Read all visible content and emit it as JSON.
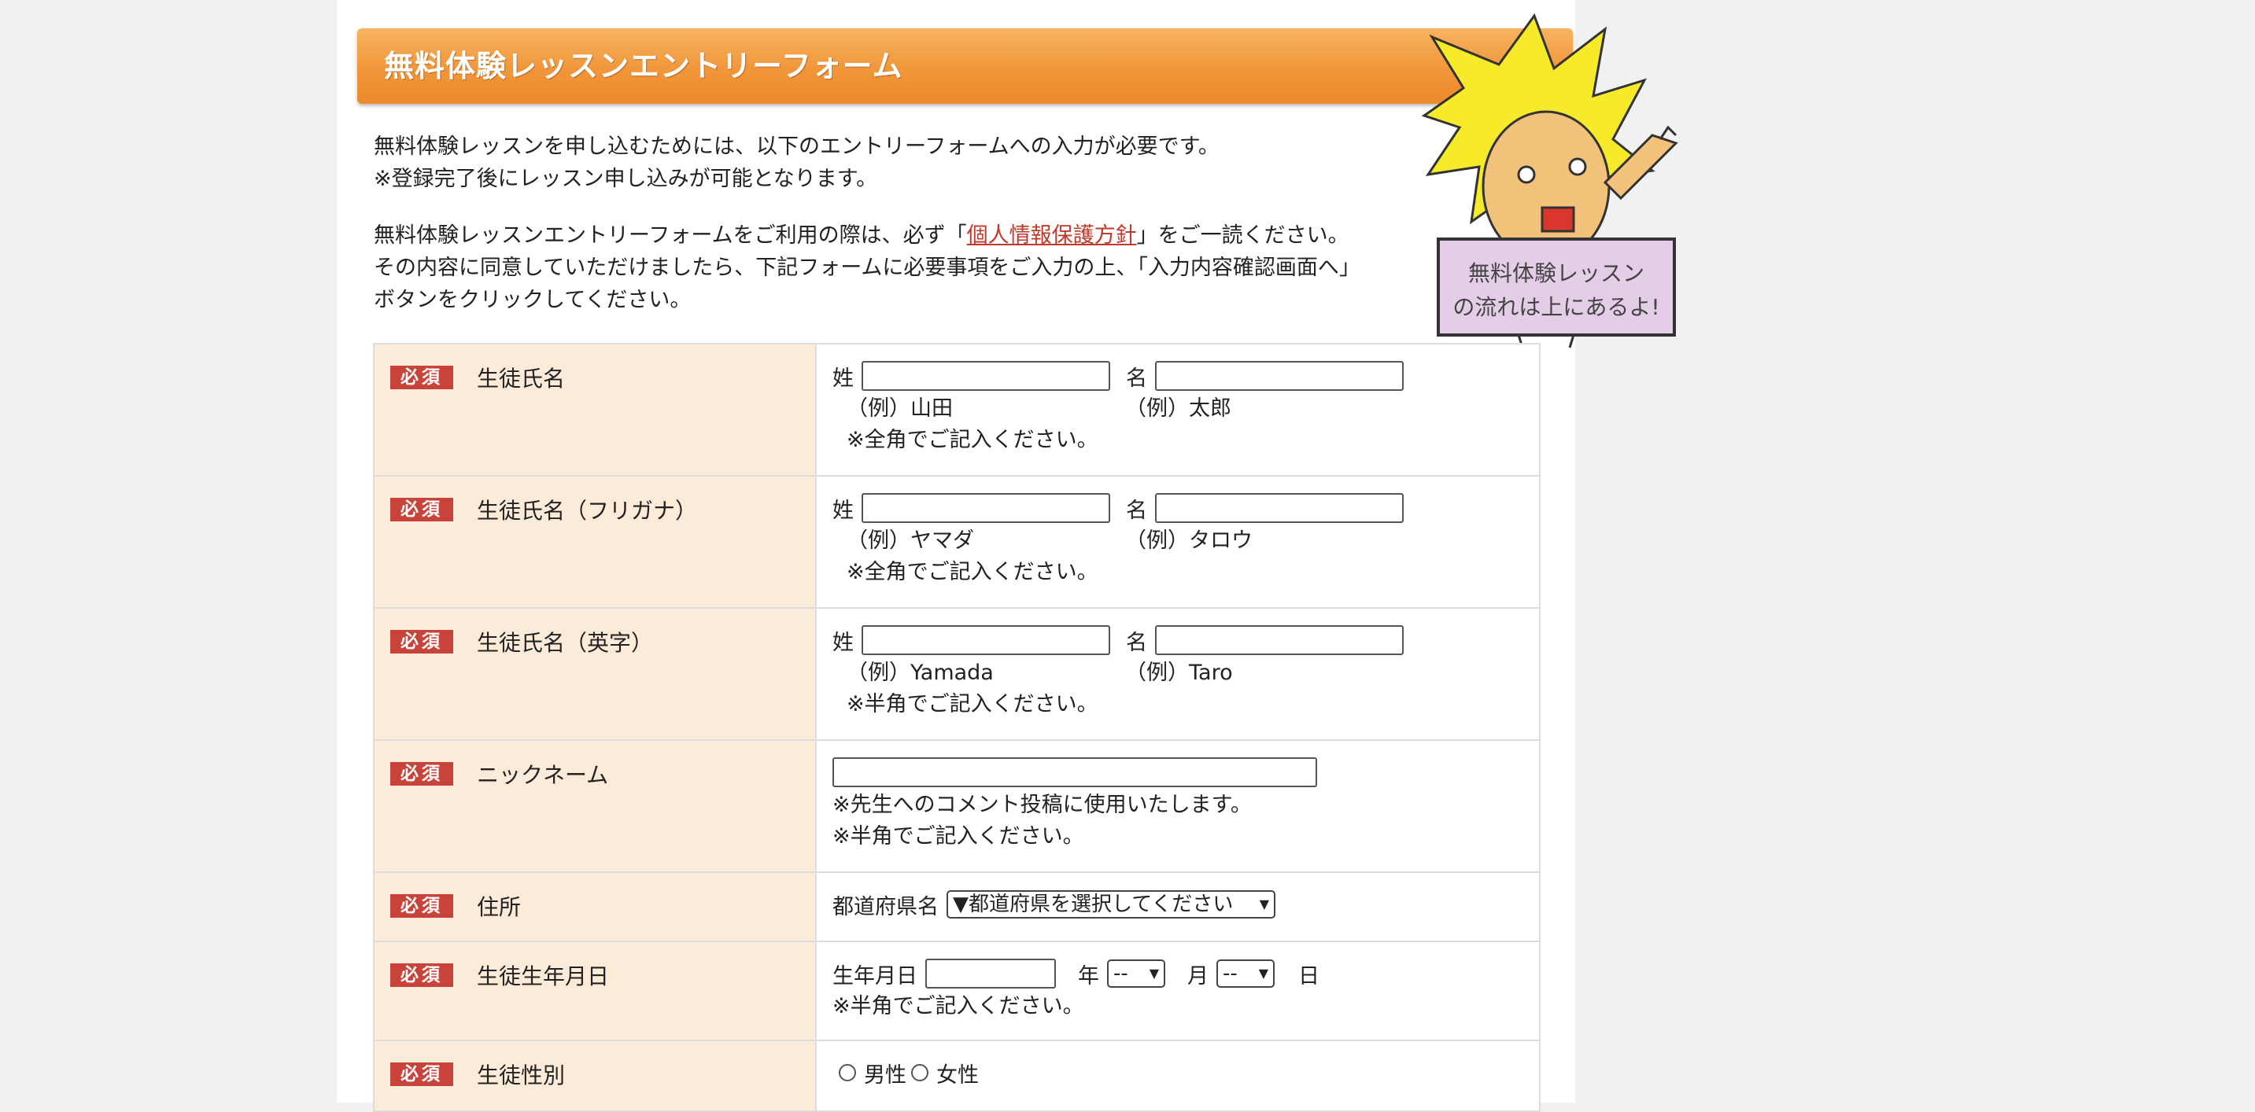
{
  "form_title": "無料体験レッスンエントリーフォーム",
  "intro": {
    "line1": "無料体験レッスンを申し込むためには、以下のエントリーフォームへの入力が必要です。",
    "line2": "※登録完了後にレッスン申し込みが可能となります。",
    "line3_pre": "無料体験レッスンエントリーフォームをご利用の際は、必ず「",
    "privacy_link": "個人情報保護方針",
    "line3_post": "」をご一読ください。",
    "line4": "その内容に同意していただけましたら、下記フォームに必要事項をご入力の上、「入力内容確認画面へ」",
    "line5": "ボタンをクリックしてください。"
  },
  "mascot": {
    "sign_line1": "無料体験レッスン",
    "sign_line2": "の流れは上にあるよ!"
  },
  "required_badge": "必須",
  "rows": {
    "name": {
      "label": "生徒氏名",
      "last_label": "姓",
      "first_label": "名",
      "last_example": "（例）山田",
      "first_example": "（例）太郎",
      "note": "※全角でご記入ください。"
    },
    "kana": {
      "label": "生徒氏名（フリガナ）",
      "last_label": "姓",
      "first_label": "名",
      "last_example": "（例）ヤマダ",
      "first_example": "（例）タロウ",
      "note": "※全角でご記入ください。"
    },
    "english": {
      "label": "生徒氏名（英字）",
      "last_label": "姓",
      "first_label": "名",
      "last_example": "（例）Yamada",
      "first_example": "（例）Taro",
      "note": "※半角でご記入ください。"
    },
    "nickname": {
      "label": "ニックネーム",
      "note1": "※先生へのコメント投稿に使用いたします。",
      "note2": "※半角でご記入ください。"
    },
    "address": {
      "label": "住所",
      "prefecture_label": "都道府県名",
      "prefecture_selected": "▼都道府県を選択してください"
    },
    "birthday": {
      "label": "生徒生年月日",
      "field_label": "生年月日",
      "year_label": "年",
      "month_label": "月",
      "day_label": "日",
      "month_selected": "--",
      "day_selected": "--",
      "note": "※半角でご記入ください。"
    },
    "gender": {
      "label": "生徒性別",
      "options": [
        "男性",
        "女性"
      ]
    }
  }
}
